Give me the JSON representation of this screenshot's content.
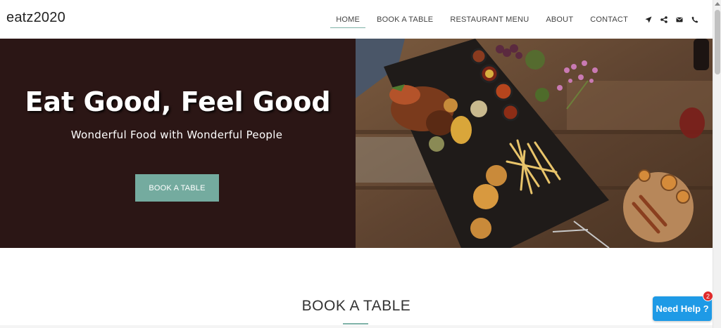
{
  "header": {
    "brand": "eatz2020",
    "nav": [
      "HOME",
      "BOOK A TABLE",
      "RESTAURANT MENU",
      "ABOUT",
      "CONTACT"
    ],
    "active_nav": "HOME",
    "icons": [
      "location-arrow-icon",
      "share-icon",
      "envelope-icon",
      "phone-icon"
    ]
  },
  "hero": {
    "title": "Eat Good, Feel Good",
    "subtitle": "Wonderful Food with Wonderful People",
    "button": "BOOK A TABLE",
    "image": "food-platter-photo"
  },
  "section": {
    "title": "BOOK A TABLE"
  },
  "help": {
    "label": "Need Help ?",
    "badge": "2"
  },
  "colors": {
    "accent": "#74ab9f",
    "hero_bg": "#2b1615",
    "help_blue": "#1e9ae6",
    "badge_red": "#e02a2a"
  }
}
